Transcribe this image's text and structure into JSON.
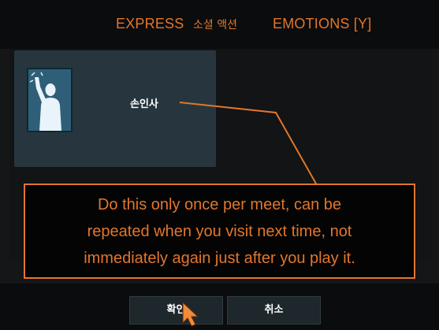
{
  "dialog": {
    "title_en_1": "EXPRESS",
    "title_ko": "소셜 액션",
    "title_en_2": "EMOTIONS [Y]"
  },
  "action_item": {
    "label": "손인사",
    "icon": "waving-person-icon"
  },
  "callout": {
    "lines": [
      "Do this only once per meet, can be",
      "repeated when you visit next time, not",
      "immediately again just after you play it."
    ],
    "color": "#e2762c"
  },
  "buttons": {
    "confirm_label": "확인",
    "cancel_label": "취소"
  },
  "cursor": {
    "icon": "arrow-cursor-icon"
  }
}
